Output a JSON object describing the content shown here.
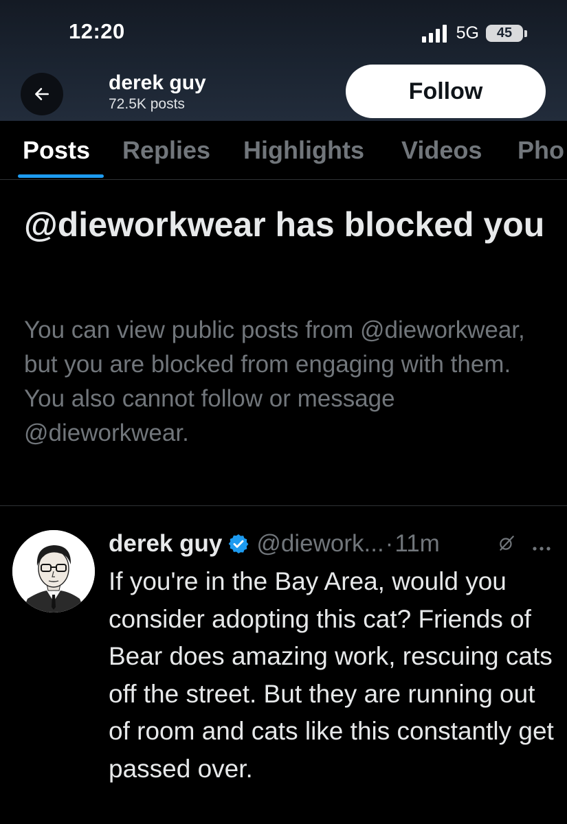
{
  "status_bar": {
    "time": "12:20",
    "network": "5G",
    "battery": "45"
  },
  "header": {
    "back_icon": "arrow-left-icon",
    "name": "derek guy",
    "posts_count": "72.5K posts",
    "follow_label": "Follow"
  },
  "tabs": [
    {
      "label": "Posts",
      "active": true
    },
    {
      "label": "Replies",
      "active": false
    },
    {
      "label": "Highlights",
      "active": false
    },
    {
      "label": "Videos",
      "active": false
    },
    {
      "label": "Pho",
      "active": false
    }
  ],
  "blocked": {
    "title": "@dieworkwear has blocked you",
    "body": "You can view public posts from @dieworkwear, but you are blocked from engaging with them. You also cannot follow or message @dieworkwear."
  },
  "post": {
    "author": "derek guy",
    "handle": "@diework...",
    "separator": "·",
    "time": "11m",
    "text": "If you're in the Bay Area, would you consider adopting this cat? Friends of Bear does amazing work, rescuing cats off the street. But they are running out of room and cats like this constantly get passed over."
  },
  "colors": {
    "background": "#000000",
    "accent": "#1d9bf0",
    "muted_text": "#71767b",
    "header_bg": "#1b2431"
  }
}
